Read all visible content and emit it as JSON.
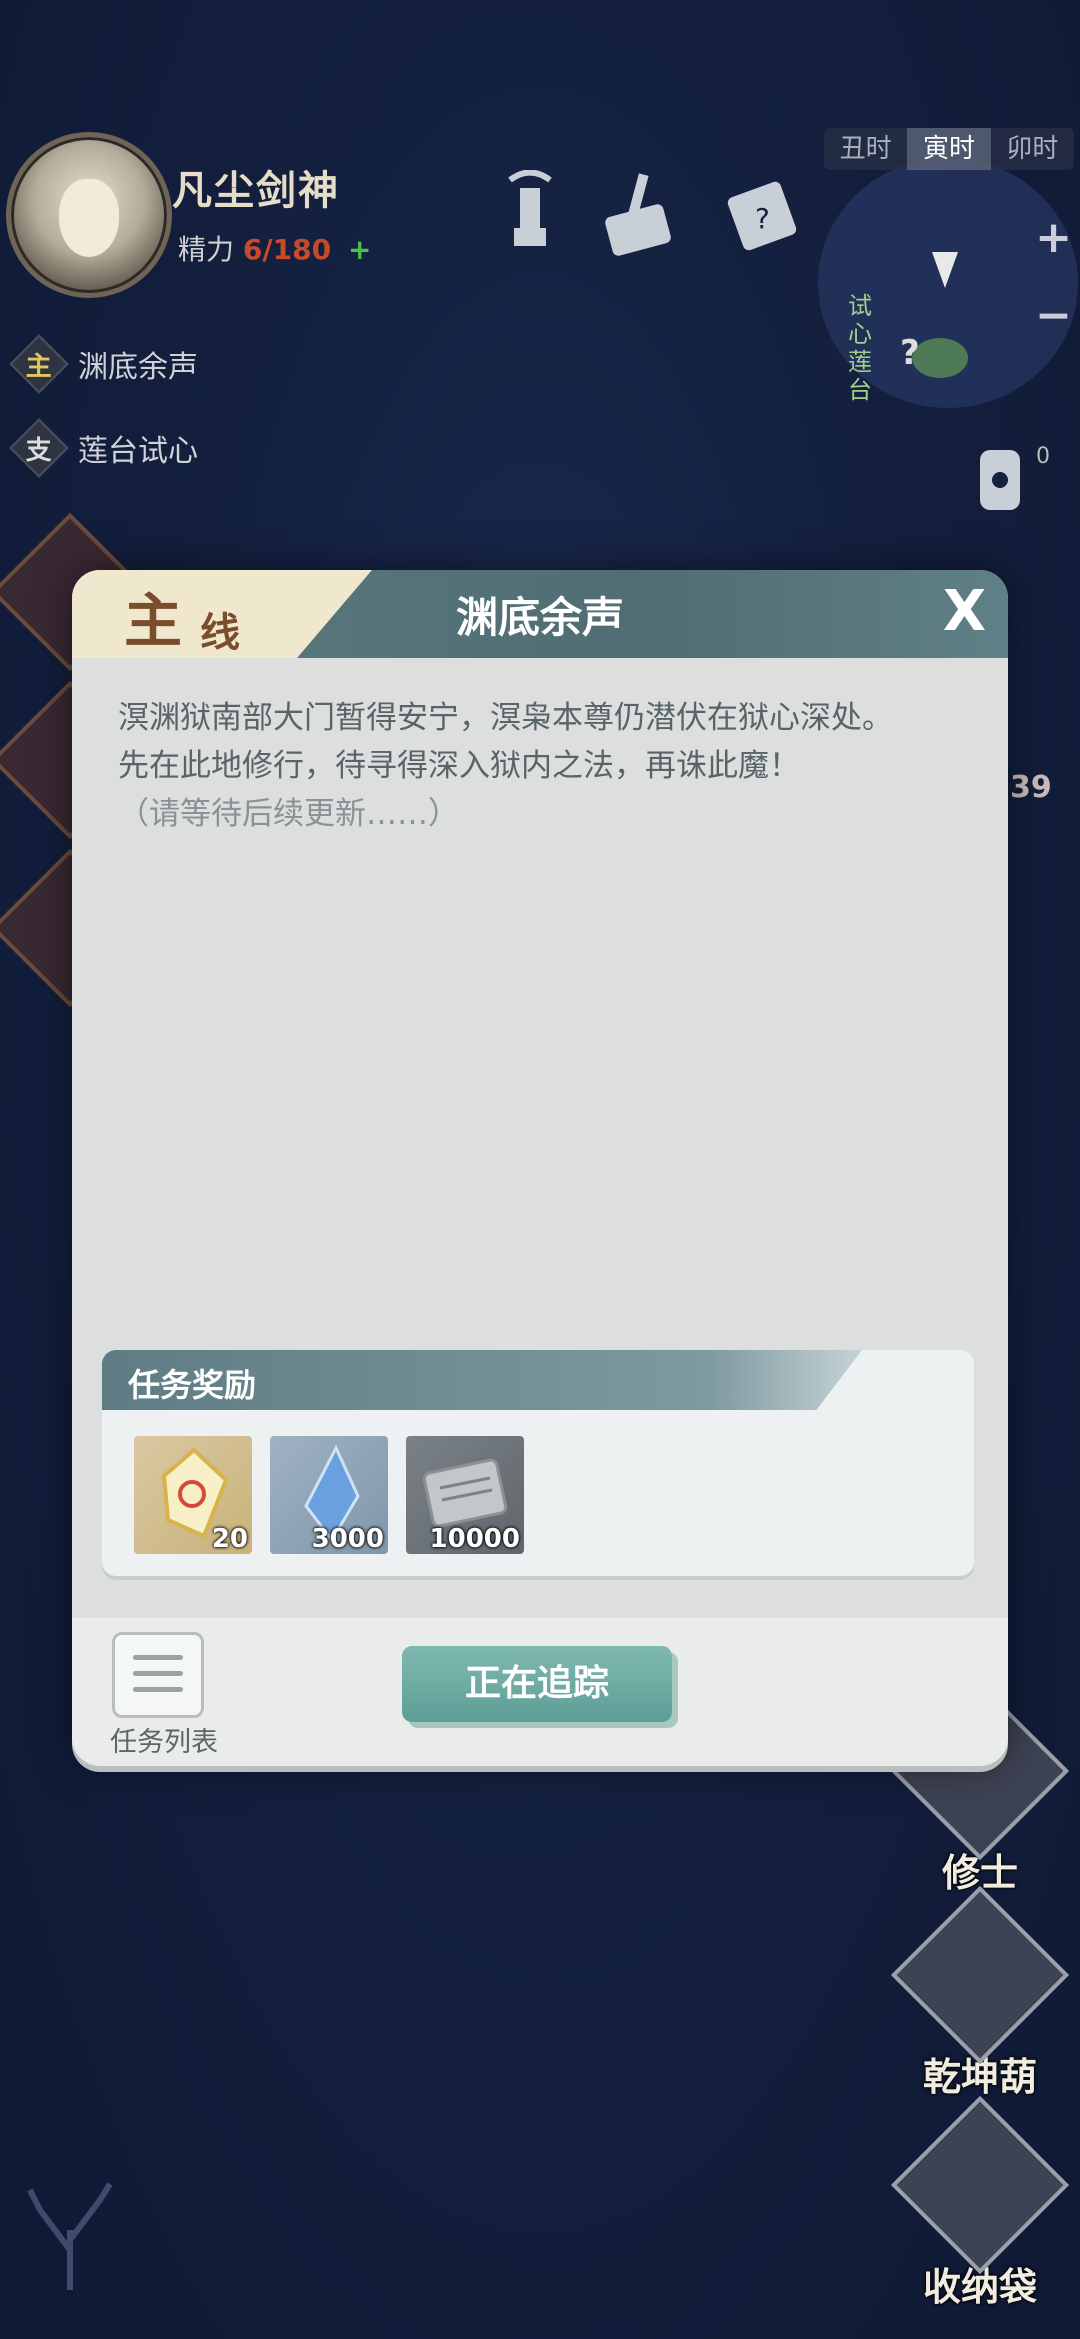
{
  "player": {
    "name": "凡尘剑神",
    "energy_label": "精力",
    "energy_value": "6/180",
    "energy_plus": "+"
  },
  "quest_tracker": [
    {
      "type": "主",
      "name": "渊底余声"
    },
    {
      "type": "支",
      "name": "莲台试心"
    }
  ],
  "time_bar": [
    "丑时",
    "寅时",
    "卯时"
  ],
  "current_time": "寅时",
  "minimap": {
    "zoom_in": "+",
    "zoom_out": "−",
    "location_label": "试心莲台"
  },
  "right_menu": [
    {
      "label": "修士"
    },
    {
      "label": "乾坤葫"
    },
    {
      "label": "收纳袋"
    }
  ],
  "side_counts": {
    "bell_badge": "0",
    "partial_number": "39"
  },
  "modal": {
    "tag_main": "主",
    "tag_sub": "线",
    "title": "渊底余声",
    "close": "X",
    "description_line1": "溟渊狱南部大门暂得安宁，溟枭本尊仍潜伏在狱心深处。",
    "description_line2": "先在此地修行，待寻得深入狱内之法，再诛此魔！",
    "description_note": "（请等待后续更新……）",
    "reward_header": "任务奖励",
    "rewards": [
      {
        "icon": "gold-talisman-icon",
        "count": "20"
      },
      {
        "icon": "blue-crystal-icon",
        "count": "3000"
      },
      {
        "icon": "silver-scroll-icon",
        "count": "10000"
      }
    ],
    "task_list_label": "任务列表",
    "track_button": "正在追踪"
  }
}
